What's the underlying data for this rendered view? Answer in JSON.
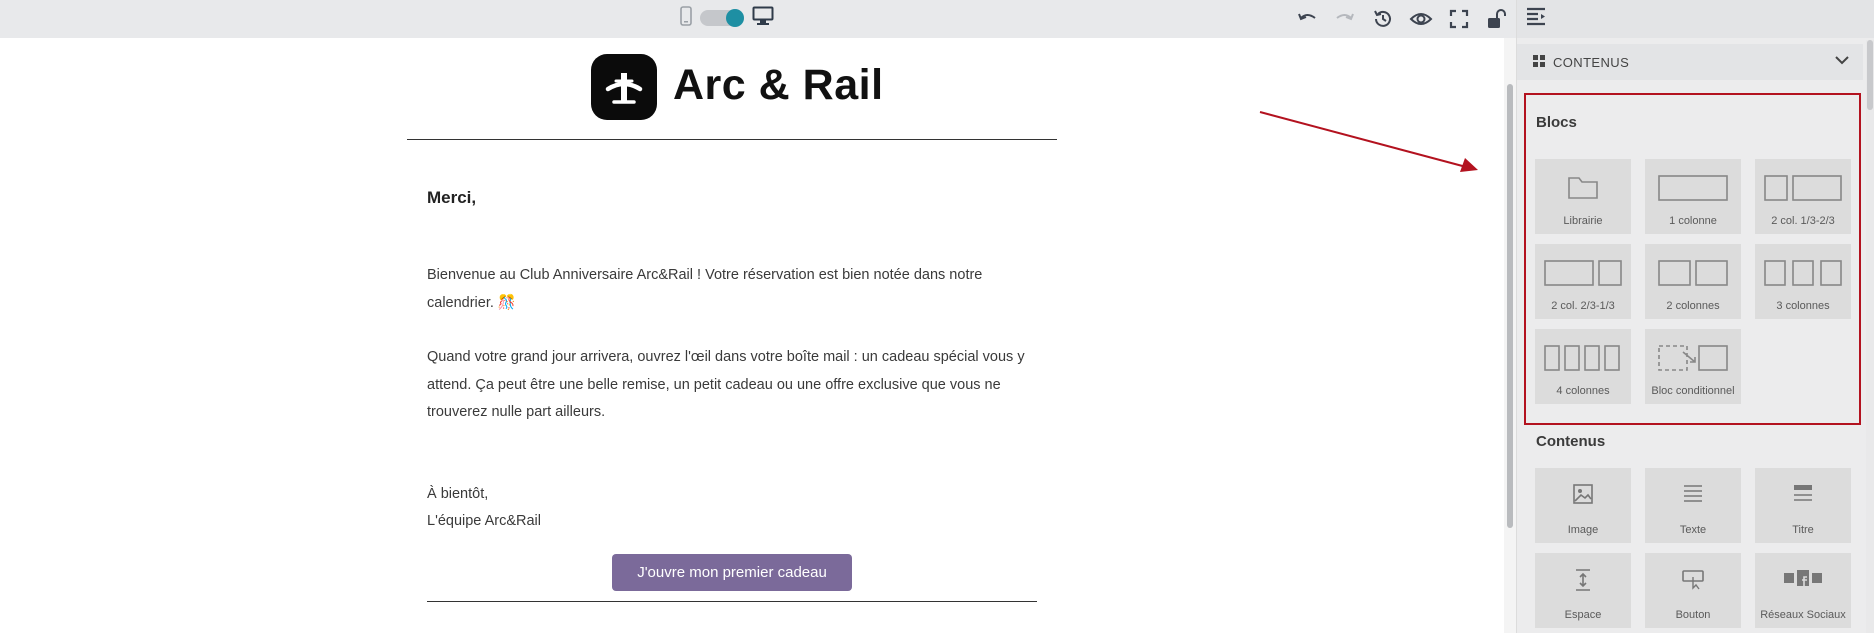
{
  "toolbar": {
    "device_mode": "desktop",
    "accent_color": "#1e8fa3",
    "icons": [
      "mobile-icon",
      "desktop-icon",
      "undo-icon",
      "redo-icon",
      "history-icon",
      "preview-eye-icon",
      "fullscreen-icon",
      "unlock-icon",
      "panel-toggle-icon"
    ]
  },
  "email": {
    "brand_name": "Arc & Rail",
    "greeting": "Merci,",
    "paragraph1": "Bienvenue au Club Anniversaire Arc&Rail ! Votre réservation est bien notée dans notre calendrier.  🎊",
    "paragraph2": "Quand votre grand jour arrivera, ouvrez l'œil dans votre boîte mail : un cadeau spécial vous y attend. Ça peut être une belle remise, un petit cadeau ou une offre exclusive que vous ne trouverez nulle part ailleurs.",
    "signoff": "À bientôt,",
    "signature": "L'équipe Arc&Rail",
    "cta_label": "J'ouvre mon premier cadeau",
    "cta_color": "#7b6a9a"
  },
  "panel": {
    "section_header": "CONTENUS",
    "blocs_title": "Blocs",
    "blocs": [
      {
        "label": "Librairie",
        "icon": "folder-icon"
      },
      {
        "label": "1 colonne",
        "icon": "one-column-icon"
      },
      {
        "label": "2 col. 1/3-2/3",
        "icon": "two-col-1-3-2-3-icon"
      },
      {
        "label": "2 col. 2/3-1/3",
        "icon": "two-col-2-3-1-3-icon"
      },
      {
        "label": "2 colonnes",
        "icon": "two-columns-icon"
      },
      {
        "label": "3 colonnes",
        "icon": "three-columns-icon"
      },
      {
        "label": "4 colonnes",
        "icon": "four-columns-icon"
      },
      {
        "label": "Bloc conditionnel",
        "icon": "conditional-block-icon"
      }
    ],
    "contenus_title": "Contenus",
    "contenus": [
      {
        "label": "Image",
        "icon": "image-icon"
      },
      {
        "label": "Texte",
        "icon": "text-icon"
      },
      {
        "label": "Titre",
        "icon": "title-icon"
      },
      {
        "label": "Espace",
        "icon": "spacer-icon"
      },
      {
        "label": "Bouton",
        "icon": "button-icon"
      },
      {
        "label": "Réseaux Sociaux",
        "icon": "social-networks-icon"
      }
    ],
    "highlight_color": "#b3121f"
  }
}
